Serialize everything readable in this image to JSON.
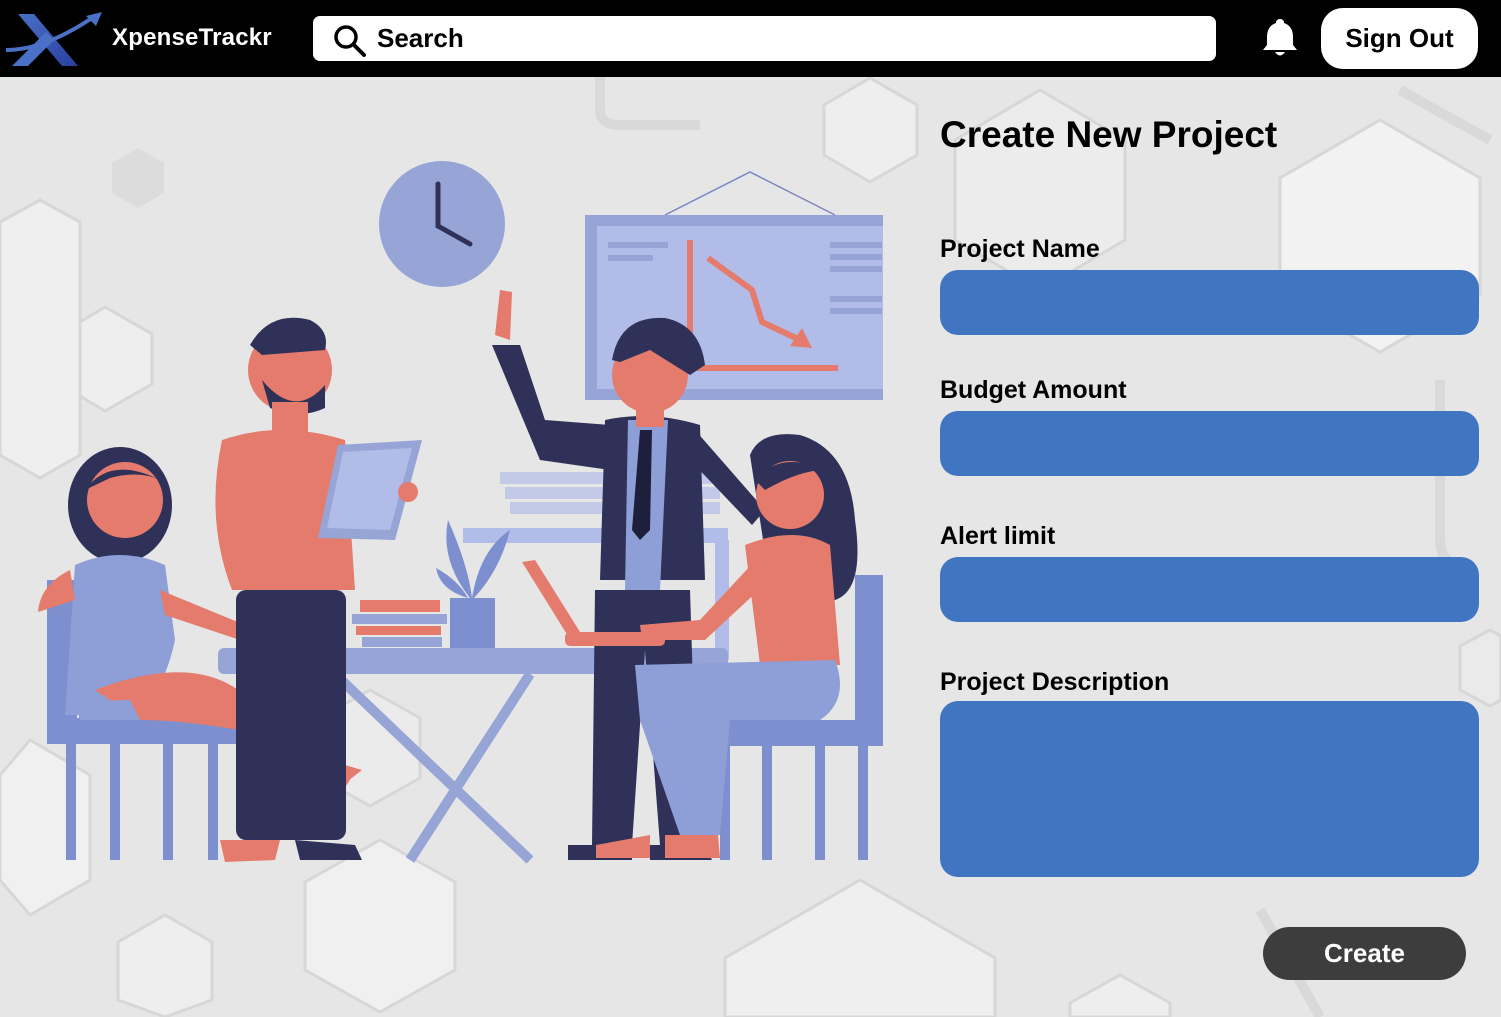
{
  "header": {
    "brand": "XpenseTrackr",
    "search_placeholder": "Search",
    "sign_out_label": "Sign Out"
  },
  "form": {
    "title": "Create New Project",
    "project_name_label": "Project Name",
    "project_name_value": "",
    "budget_label": "Budget Amount",
    "budget_value": "",
    "alert_label": "Alert limit",
    "alert_value": "",
    "description_label": "Project Description",
    "description_value": "",
    "create_label": "Create"
  },
  "icons": [
    "logo-icon",
    "search-icon",
    "bell-icon"
  ],
  "colors": {
    "header_bg": "#000000",
    "field_bg": "#4075c1",
    "create_bg": "#3d3d3d",
    "page_bg": "#e6e6e6",
    "illustration_blue": "#8d9fd6",
    "illustration_coral": "#e57b6c",
    "illustration_navy": "#2f3158"
  }
}
